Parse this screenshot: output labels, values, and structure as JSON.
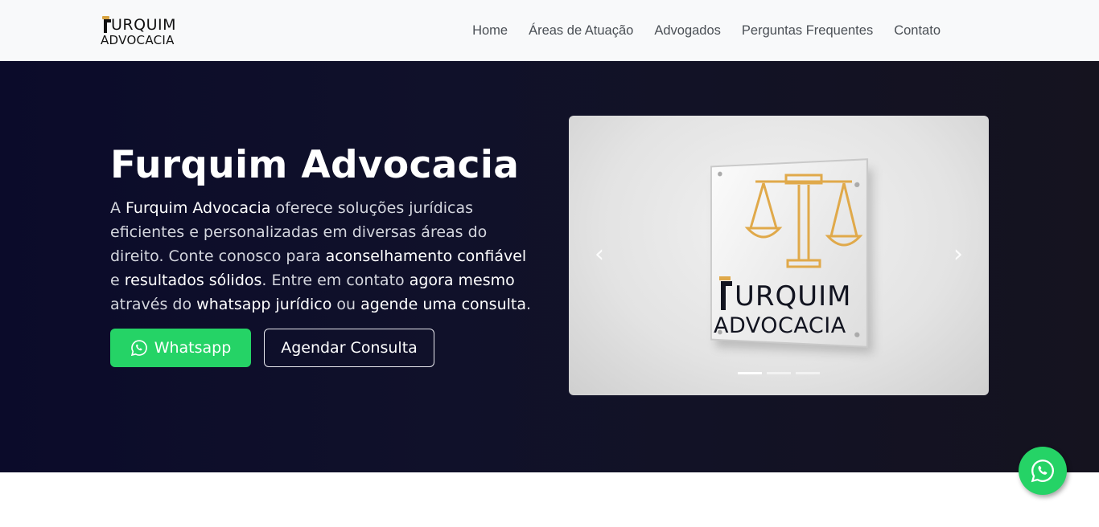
{
  "brand": {
    "logo_top": "URQUIM",
    "logo_bottom": "ADVOCACIA",
    "colors": {
      "gold": "#d9a441",
      "dark": "#111111"
    }
  },
  "nav": {
    "items": [
      {
        "label": "Home"
      },
      {
        "label": "Áreas de Atuação"
      },
      {
        "label": "Advogados"
      },
      {
        "label": "Perguntas Frequentes"
      },
      {
        "label": "Contato"
      }
    ]
  },
  "hero": {
    "title": "Furquim Advocacia",
    "description": {
      "p1": "A ",
      "b1": "Furquim Advocacia",
      "p2": " oferece soluções jurídicas eficientes e personalizadas em diversas áreas do direito. Conte conosco para ",
      "b2": "aconselhamento confiável",
      "p3": " e ",
      "b3": "resultados sólidos",
      "p4": ". Entre em contato ",
      "b4": "agora mesmo",
      "p5": " através do ",
      "b5": "whatsapp jurídico",
      "p6": " ou ",
      "b6": "agende uma consulta",
      "p7": "."
    },
    "whatsapp_button": "Whatsapp",
    "schedule_button": "Agendar Consulta",
    "background_color": "#0b0b2a"
  },
  "carousel": {
    "plate_word1": "URQUIM",
    "plate_word2": "ADVOCACIA",
    "prev_icon": "chevron-left-icon",
    "next_icon": "chevron-right-icon",
    "slide_count": 3,
    "active_slide": 1
  },
  "floating_whatsapp": {
    "icon": "whatsapp-icon",
    "color": "#25d366"
  }
}
